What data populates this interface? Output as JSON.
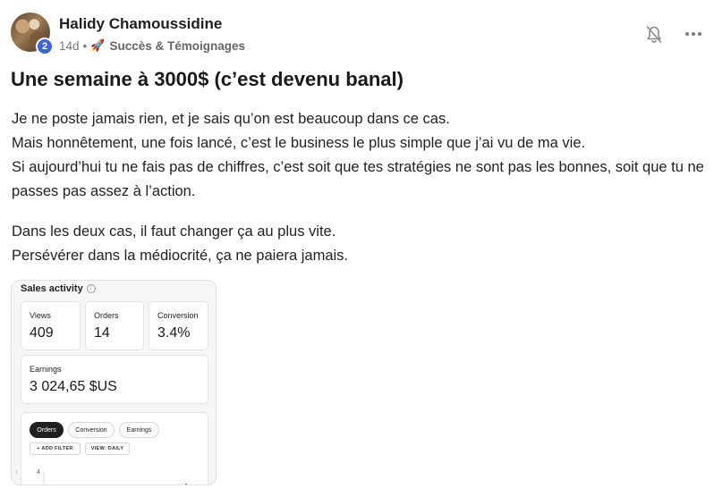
{
  "post": {
    "author": {
      "name": "Halidy Chamoussidine",
      "level": "2"
    },
    "meta": {
      "age": "14d",
      "separator": "•",
      "category_icon": "rocket-icon",
      "category": "Succès & Témoignages"
    },
    "actions": {
      "notify_icon": "bell-off-icon",
      "more_icon": "more-horizontal-icon"
    },
    "title": "Une semaine à 3000$ (c’est devenu banal)",
    "body": {
      "paragraph1": [
        "Je ne poste jamais rien, et je sais qu’on est beaucoup dans ce cas.",
        "Mais honnêtement, une fois lancé, c’est le business le plus simple que j’ai vu de ma vie.",
        "Si aujourd’hui tu ne fais pas de chiffres, c’est soit que tes stratégies ne sont pas les bonnes, soit que tu ne passes pas assez à l’action."
      ],
      "paragraph2": [
        "Dans les deux cas, il faut changer ça au plus vite.",
        "Persévérer dans la médiocrité, ça ne paiera jamais."
      ]
    },
    "attachment": {
      "title": "Sales activity",
      "info_icon": "i",
      "stats": [
        {
          "label": "Views",
          "value": "409"
        },
        {
          "label": "Orders",
          "value": "14"
        },
        {
          "label": "Conversion",
          "value": "3.4%"
        }
      ],
      "earnings": {
        "label": "Earnings",
        "value": "3 024,65 $US"
      },
      "tabs": [
        {
          "label": "Orders",
          "active": true
        },
        {
          "label": "Conversion",
          "active": false
        },
        {
          "label": "Earnings",
          "active": false
        }
      ],
      "add_filter": "+ ADD FILTER",
      "view_daily": "VIEW: DAILY",
      "y_tick": "4",
      "y_axis_label": "↕"
    }
  }
}
